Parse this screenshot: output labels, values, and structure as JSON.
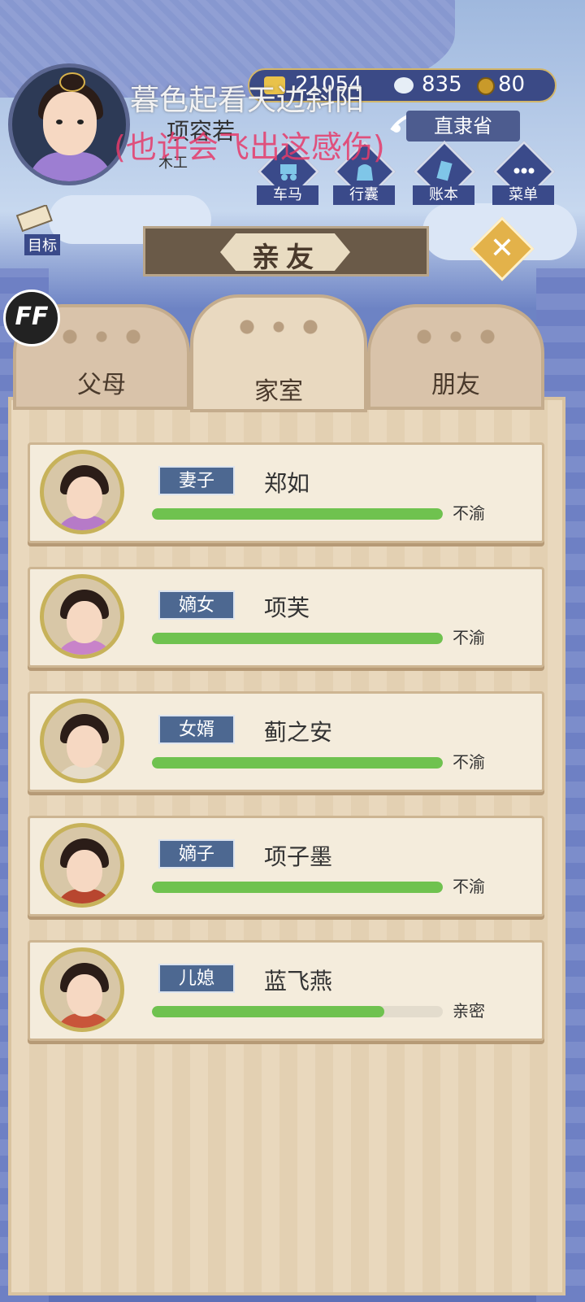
{
  "overlay": {
    "lyric_top": "暮色起看天边斜阳",
    "lyric_bottom": "(也许会飞出这感伤)"
  },
  "player": {
    "name": "项容若",
    "title": "木工"
  },
  "currency": {
    "gold": "21054",
    "silver": "835",
    "coins": "80"
  },
  "location": "直隶省",
  "top_menu": [
    {
      "label": "车马",
      "icon": "carriage-icon"
    },
    {
      "label": "行囊",
      "icon": "bag-icon"
    },
    {
      "label": "账本",
      "icon": "ledger-icon"
    },
    {
      "label": "菜单",
      "icon": "more-icon"
    }
  ],
  "goal_label": "目标",
  "title": "亲友",
  "ff_badge": "FF",
  "tabs": [
    {
      "label": "父母",
      "active": false
    },
    {
      "label": "家室",
      "active": true
    },
    {
      "label": "朋友",
      "active": false
    }
  ],
  "members": [
    {
      "relation": "妻子",
      "name": "郑如",
      "status": "不渝",
      "affinity": 1.0,
      "robe_color": "#b67ac8"
    },
    {
      "relation": "嫡女",
      "name": "项芙",
      "status": "不渝",
      "affinity": 1.0,
      "robe_color": "#c883c9"
    },
    {
      "relation": "女婿",
      "name": "蓟之安",
      "status": "不渝",
      "affinity": 1.0,
      "robe_color": "#e6dcc8"
    },
    {
      "relation": "嫡子",
      "name": "项子墨",
      "status": "不渝",
      "affinity": 1.0,
      "robe_color": "#b8462f"
    },
    {
      "relation": "儿媳",
      "name": "蓝飞燕",
      "status": "亲密",
      "affinity": 0.8,
      "robe_color": "#c8553a"
    }
  ],
  "colors": {
    "bar_fill": "#6fc24f",
    "relation_tag": "#4d6891",
    "frame_gold": "#c7b25a"
  }
}
